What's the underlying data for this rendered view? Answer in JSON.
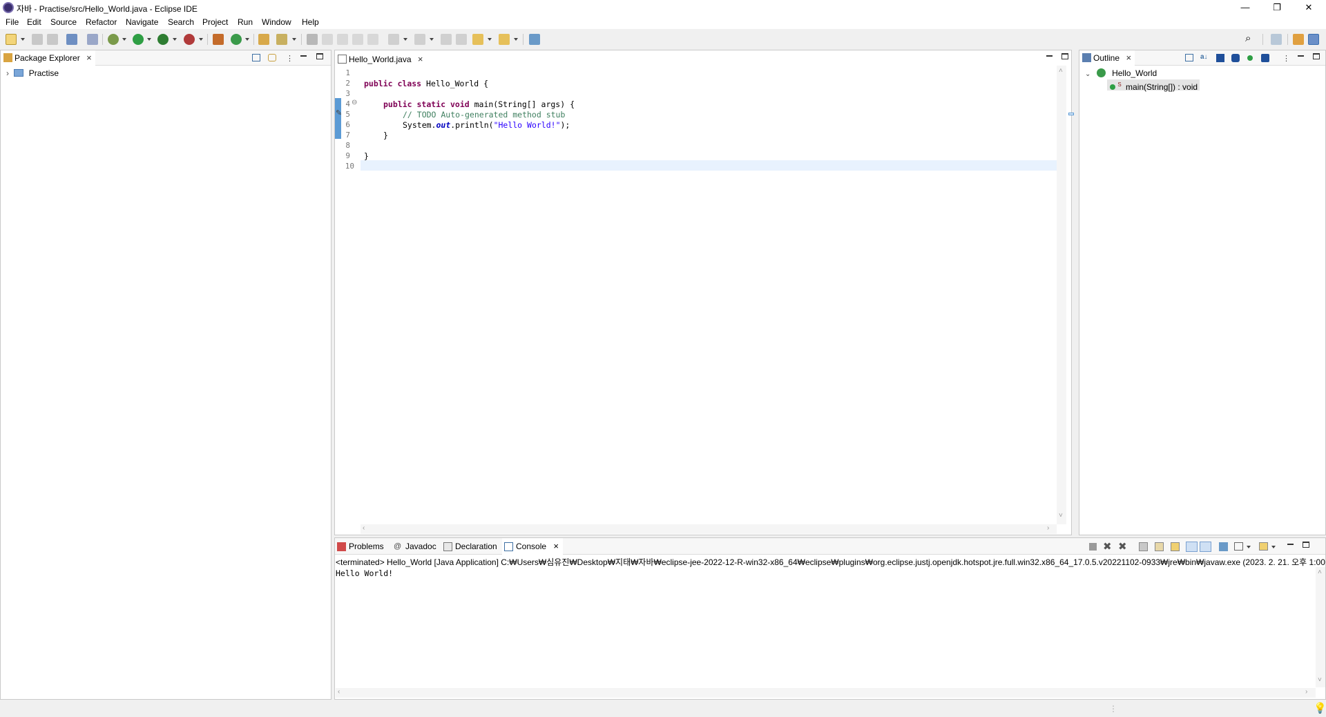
{
  "window": {
    "title": "자바 - Practise/src/Hello_World.java - Eclipse IDE",
    "minimize": "—",
    "restore": "❐",
    "close": "✕"
  },
  "menu": [
    "File",
    "Edit",
    "Source",
    "Refactor",
    "Navigate",
    "Search",
    "Project",
    "Run",
    "Window",
    "Help"
  ],
  "package_explorer": {
    "tab_label": "Package Explorer",
    "project": "Practise"
  },
  "editor": {
    "tab_label": "Hello_World.java",
    "line_numbers": [
      "1",
      "2",
      "3",
      "4",
      "5",
      "6",
      "7",
      "8",
      "9",
      "10"
    ],
    "fold_marker": "⊖",
    "lines": {
      "l2_kw1": "public",
      "l2_kw2": "class",
      "l2_rest": " Hello_World {",
      "l4_kw1": "public",
      "l4_kw2": "static",
      "l4_kw3": "void",
      "l4_rest": " main(String[] args) {",
      "l5_comment": "// TODO Auto-generated method stub",
      "l6_pre": "System.",
      "l6_field": "out",
      "l6_mid": ".println(",
      "l6_str": "\"Hello World!\"",
      "l6_end": ");",
      "l7": "}",
      "l9": "}"
    }
  },
  "outline": {
    "tab_label": "Outline",
    "class_name": "Hello_World",
    "method": "main(String[]) : void"
  },
  "bottom_tabs": {
    "problems": "Problems",
    "javadoc": "Javadoc",
    "declaration": "Declaration",
    "console": "Console"
  },
  "console": {
    "header": "<terminated> Hello_World [Java Application] C:₩Users₩심유진₩Desktop₩지태₩자바₩eclipse-jee-2022-12-R-win32-x86_64₩eclipse₩plugins₩org.eclipse.justj.openjdk.hotspot.jre.full.win32.x86_64_17.0.5.v20221102-0933₩jre₩bin₩javaw.exe  (2023. 2. 21. 오후 1:00",
    "output": "Hello World!"
  },
  "icons": {
    "java_file": "java-file-icon",
    "package": "package-icon",
    "class": "class-icon",
    "method": "public-method-icon"
  },
  "colors": {
    "keyword": "#7f0055",
    "comment": "#3f7f5f",
    "string": "#2a00ff",
    "field": "#0000c0",
    "current_line": "#e8f2fe",
    "selection_marker": "#5b9bd5"
  }
}
